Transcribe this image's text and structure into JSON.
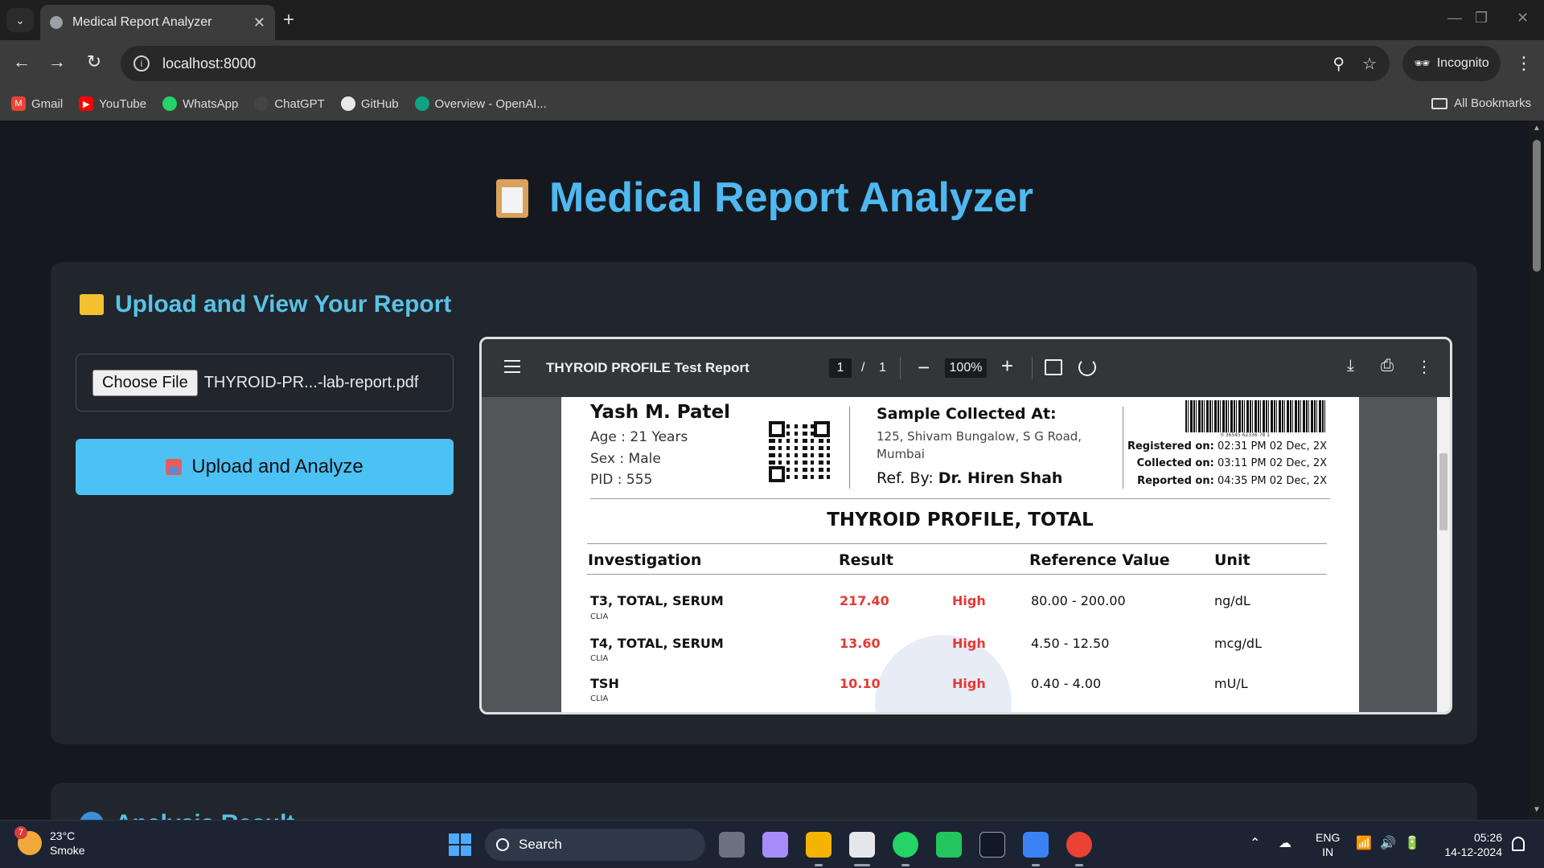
{
  "browser": {
    "tab_title": "Medical Report Analyzer",
    "url": "localhost:8000",
    "incognito_label": "Incognito",
    "bookmarks": [
      {
        "label": "Gmail",
        "icon": "gmail-icon",
        "color": "#ea4335"
      },
      {
        "label": "YouTube",
        "icon": "youtube-icon",
        "color": "#ff0000"
      },
      {
        "label": "WhatsApp",
        "icon": "whatsapp-icon",
        "color": "#25d366"
      },
      {
        "label": "ChatGPT",
        "icon": "chatgpt-icon",
        "color": "#444444"
      },
      {
        "label": "GitHub",
        "icon": "github-icon",
        "color": "#333333"
      },
      {
        "label": "Overview - OpenAI...",
        "icon": "openai-icon",
        "color": "#10a37f"
      }
    ],
    "all_bookmarks_label": "All Bookmarks"
  },
  "app": {
    "title": "Medical Report Analyzer",
    "accent_color": "#4fb8f0"
  },
  "upload_card": {
    "title": "Upload and View Your Report",
    "choose_file_label": "Choose File",
    "file_name": "THYROID-PR...-lab-report.pdf",
    "upload_button_label": "Upload and Analyze"
  },
  "pdf_viewer": {
    "document_title": "THYROID PROFILE Test Report",
    "current_page": "1",
    "page_separator": "/",
    "total_pages": "1",
    "zoom": "100%"
  },
  "report": {
    "patient_name": "Yash M. Patel",
    "age": "Age : 21 Years",
    "sex": "Sex : Male",
    "pid": "PID : 555",
    "sample_collected_title": "Sample Collected At:",
    "sample_address_1": "125, Shivam Bungalow, S G Road,",
    "sample_address_2": "Mumbai",
    "ref_by_label": "Ref. By:",
    "ref_by_doctor": "Dr. Hiren Shah",
    "barcode_number": "0 36545 62336 78 1",
    "registered_label": "Registered on:",
    "registered_value": "02:31 PM 02 Dec, 2X",
    "collected_label": "Collected on:",
    "collected_value": "03:11 PM 02 Dec, 2X",
    "reported_label": "Reported on:",
    "reported_value": "04:35 PM 02 Dec, 2X",
    "report_title": "THYROID PROFILE, TOTAL",
    "columns": [
      "Investigation",
      "Result",
      "Reference Value",
      "Unit"
    ],
    "rows": [
      {
        "name": "T3, TOTAL, SERUM",
        "method": "CLIA",
        "result": "217.40",
        "flag": "High",
        "reference": "80.00 - 200.00",
        "unit": "ng/dL"
      },
      {
        "name": "T4, TOTAL, SERUM",
        "method": "CLIA",
        "result": "13.60",
        "flag": "High",
        "reference": "4.50 - 12.50",
        "unit": "mcg/dL"
      },
      {
        "name": "TSH",
        "method": "CLIA",
        "result": "10.10",
        "flag": "High",
        "reference": "0.40 - 4.00",
        "unit": "mU/L"
      }
    ],
    "high_color": "#e53935"
  },
  "analysis_card": {
    "title": "Analysis Result"
  },
  "taskbar": {
    "weather_temp": "23°C",
    "weather_desc": "Smoke",
    "weather_badge": "7",
    "search_placeholder": "Search",
    "lang_1": "ENG",
    "lang_2": "IN",
    "time": "05:26",
    "date": "14-12-2024"
  }
}
